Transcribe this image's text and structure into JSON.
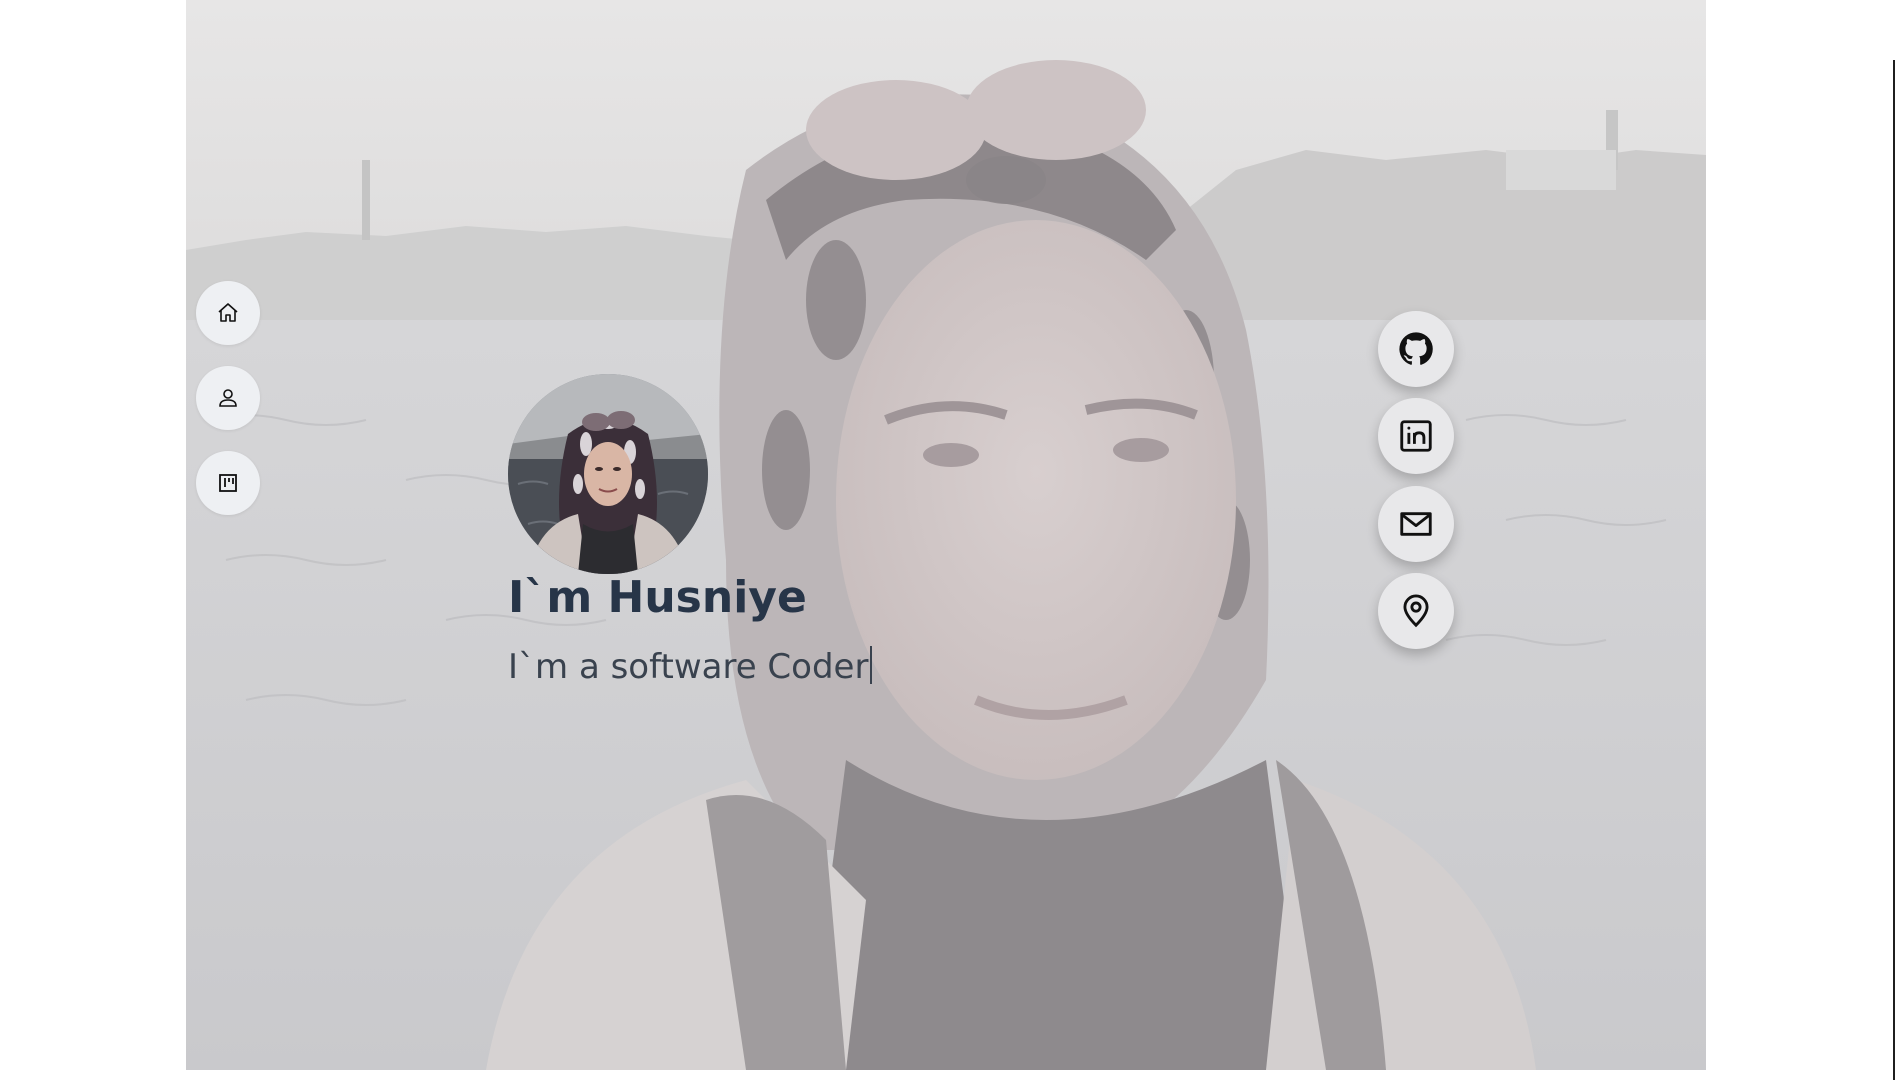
{
  "hero": {
    "title": "I`m Husniye",
    "subtitle": "I`m a software Coder",
    "avatar_alt": "profile-photo"
  },
  "left_nav": [
    {
      "name": "nav-home",
      "icon": "home-icon"
    },
    {
      "name": "nav-about",
      "icon": "user-icon"
    },
    {
      "name": "nav-projects",
      "icon": "kanban-icon"
    }
  ],
  "social": [
    {
      "name": "github-link",
      "icon": "github-icon"
    },
    {
      "name": "linkedin-link",
      "icon": "linkedin-icon"
    },
    {
      "name": "email-link",
      "icon": "mail-icon"
    },
    {
      "name": "location-link",
      "icon": "location-pin-icon"
    }
  ],
  "colors": {
    "title": "#273548",
    "subtitle": "#39424e",
    "nav_bg": "#eef0f3",
    "social_bg": "#e8e8ea"
  }
}
